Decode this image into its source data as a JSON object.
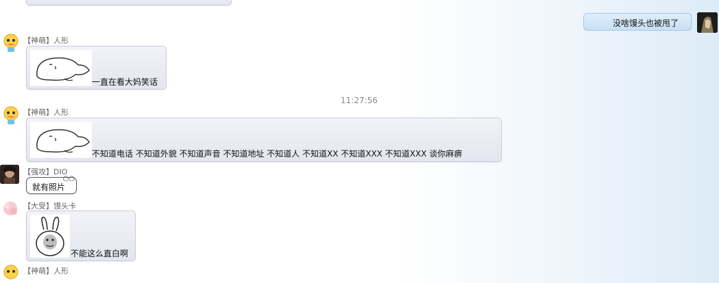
{
  "top_bubble": {},
  "messages": [
    {
      "sender": "",
      "text": "没啥馒头也被甩了",
      "self": true
    },
    {
      "sender_tag": "【神萌】",
      "sender_name": "人形",
      "text": "一直在看大妈笑话"
    },
    {
      "timestamp": "11:27:56"
    },
    {
      "sender_tag": "【神萌】",
      "sender_name": "人形",
      "text": "不知道电话 不知道外貌 不知道声音 不知道地址 不知道人 不知道XX 不知道XXX 不知道XXX 谈你麻痹"
    },
    {
      "sender_tag": "【强攻】",
      "sender_name": "DIO",
      "text": "就有照片"
    },
    {
      "sender_tag": "【大受】",
      "sender_name": "馒头卡",
      "text": "不能这么直白啊"
    },
    {
      "sender_tag": "【神萌】",
      "sender_name": "人形",
      "text": ""
    }
  ]
}
